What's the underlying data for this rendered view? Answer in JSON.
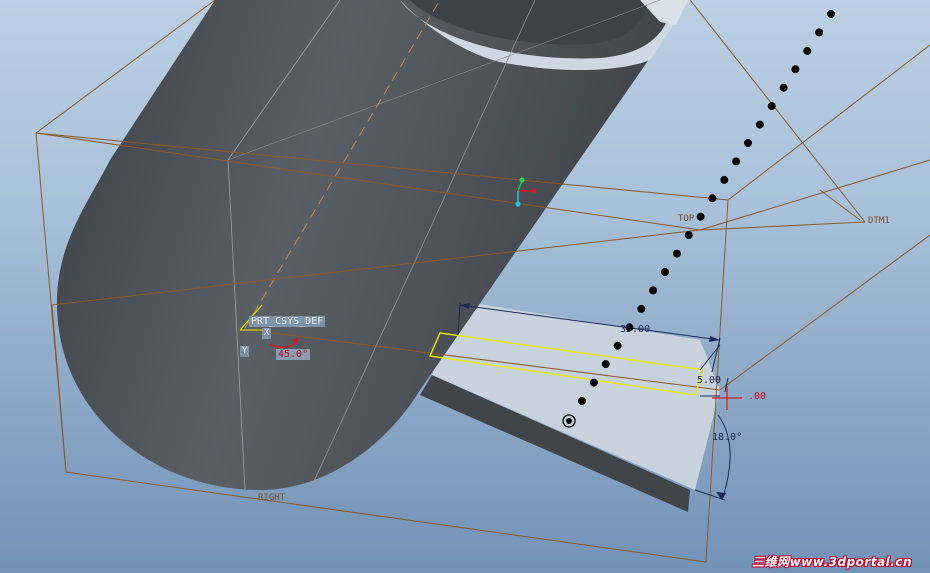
{
  "viewport": {
    "csys_label": "PRT_CSYS_DEF",
    "angle_label": "45.0°",
    "small_tag_1": "X",
    "small_tag_2": "Y"
  },
  "datum_planes": {
    "top": "TOP",
    "right": "RIGHT",
    "dtm1": "DTM1"
  },
  "dimensions": {
    "length": "35.00",
    "width": "5.00",
    "offset": ".00",
    "angle": "18.0°"
  },
  "colors": {
    "background_top": "#bccfe3",
    "background_bottom": "#7392b8",
    "body_shade": "#4a4e54",
    "face_light": "#c6d2de",
    "datum_edge": "#8a5a2b",
    "sketch_highlight": "#e6e600",
    "dimension": "#1a2a5a"
  },
  "watermark": "三维网www.3dportal.cn"
}
